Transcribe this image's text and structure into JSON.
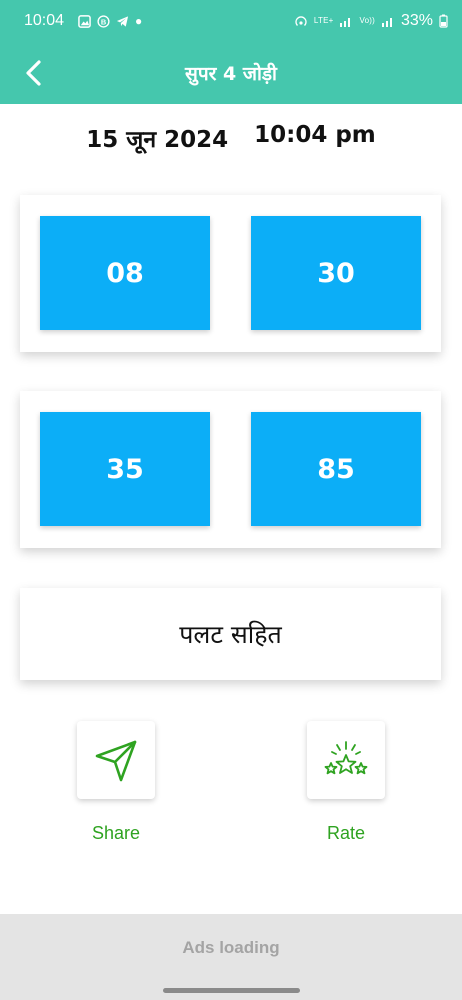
{
  "status_bar": {
    "time": "10:04",
    "lte1": "LTE+",
    "lte2": "Vo))",
    "battery": "33%"
  },
  "app_bar": {
    "title": "सुपर 4 जोड़ी",
    "back_icon": "chevron-left-icon"
  },
  "date": "15 जून 2024",
  "time": "10:04 pm",
  "pairs": [
    {
      "left": "08",
      "right": "30"
    },
    {
      "left": "35",
      "right": "85"
    }
  ],
  "note": "पलट सहित",
  "actions": {
    "share": {
      "label": "Share",
      "icon": "send-icon"
    },
    "rate": {
      "label": "Rate",
      "icon": "stars-icon"
    }
  },
  "ads": "Ads loading",
  "colors": {
    "accent": "#45c7ad",
    "number_box": "#0caef7",
    "action_green": "#2fa321"
  }
}
